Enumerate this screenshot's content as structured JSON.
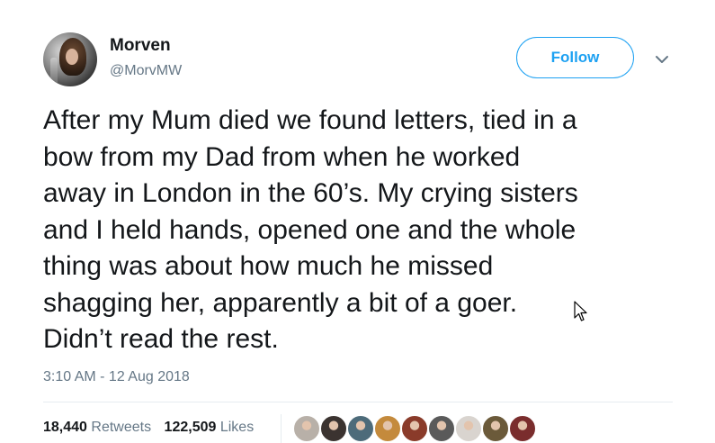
{
  "user": {
    "name": "Morven",
    "handle": "@MorvMW",
    "avatar_icon": "user-avatar"
  },
  "follow_button": {
    "label": "Follow"
  },
  "menu": {
    "icon": "chevron-down-icon"
  },
  "tweet": {
    "lines": [
      "After my Mum died we found letters, tied in a",
      "bow from my Dad from when he worked",
      "away in London in the 60’s. My crying sisters",
      "and I held hands, opened one and the whole",
      "thing was about how much he missed",
      "shagging her, apparently a bit of a goer.",
      "Didn’t read the rest."
    ]
  },
  "timestamp": "3:10 AM - 12 Aug 2018",
  "stats": {
    "retweets_count": "18,440",
    "retweets_label": "Retweets",
    "likes_count": "122,509",
    "likes_label": "Likes"
  },
  "likers": [
    {
      "icon": "liker-avatar",
      "color": "#b8b0a8"
    },
    {
      "icon": "liker-avatar",
      "color": "#3b3330"
    },
    {
      "icon": "liker-avatar",
      "color": "#4d6b7a"
    },
    {
      "icon": "liker-avatar",
      "color": "#c48a3c"
    },
    {
      "icon": "liker-avatar",
      "color": "#8a3b2a"
    },
    {
      "icon": "liker-avatar",
      "color": "#5a5a5a"
    },
    {
      "icon": "liker-avatar",
      "color": "#d9d4cf"
    },
    {
      "icon": "liker-avatar",
      "color": "#6b5a3a"
    },
    {
      "icon": "liker-avatar",
      "color": "#7a2d2d"
    }
  ],
  "colors": {
    "accent": "#1da1f2",
    "text": "#14171a",
    "secondary": "#657786",
    "divider": "#e6ecf0"
  }
}
